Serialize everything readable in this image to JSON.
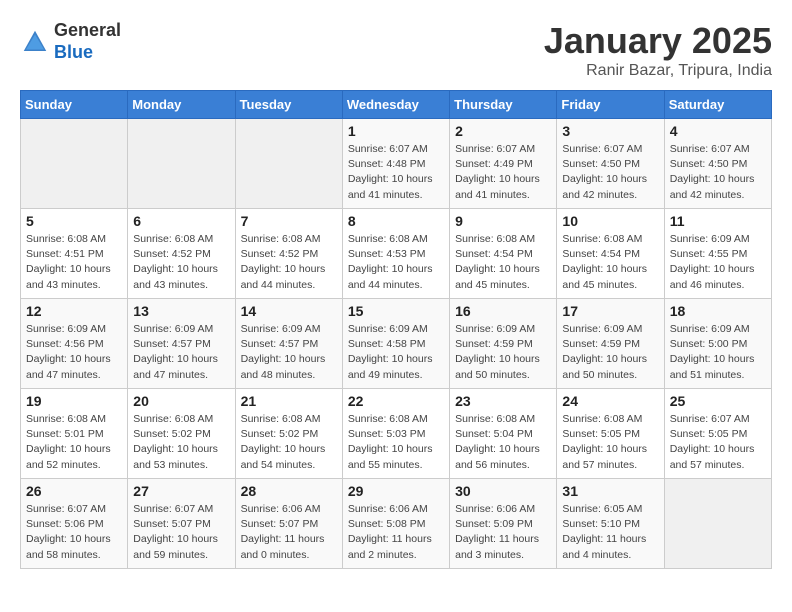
{
  "header": {
    "logo_general": "General",
    "logo_blue": "Blue",
    "title": "January 2025",
    "subtitle": "Ranir Bazar, Tripura, India"
  },
  "days_of_week": [
    "Sunday",
    "Monday",
    "Tuesday",
    "Wednesday",
    "Thursday",
    "Friday",
    "Saturday"
  ],
  "weeks": [
    [
      {
        "day": "",
        "info": ""
      },
      {
        "day": "",
        "info": ""
      },
      {
        "day": "",
        "info": ""
      },
      {
        "day": "1",
        "info": "Sunrise: 6:07 AM\nSunset: 4:48 PM\nDaylight: 10 hours\nand 41 minutes."
      },
      {
        "day": "2",
        "info": "Sunrise: 6:07 AM\nSunset: 4:49 PM\nDaylight: 10 hours\nand 41 minutes."
      },
      {
        "day": "3",
        "info": "Sunrise: 6:07 AM\nSunset: 4:50 PM\nDaylight: 10 hours\nand 42 minutes."
      },
      {
        "day": "4",
        "info": "Sunrise: 6:07 AM\nSunset: 4:50 PM\nDaylight: 10 hours\nand 42 minutes."
      }
    ],
    [
      {
        "day": "5",
        "info": "Sunrise: 6:08 AM\nSunset: 4:51 PM\nDaylight: 10 hours\nand 43 minutes."
      },
      {
        "day": "6",
        "info": "Sunrise: 6:08 AM\nSunset: 4:52 PM\nDaylight: 10 hours\nand 43 minutes."
      },
      {
        "day": "7",
        "info": "Sunrise: 6:08 AM\nSunset: 4:52 PM\nDaylight: 10 hours\nand 44 minutes."
      },
      {
        "day": "8",
        "info": "Sunrise: 6:08 AM\nSunset: 4:53 PM\nDaylight: 10 hours\nand 44 minutes."
      },
      {
        "day": "9",
        "info": "Sunrise: 6:08 AM\nSunset: 4:54 PM\nDaylight: 10 hours\nand 45 minutes."
      },
      {
        "day": "10",
        "info": "Sunrise: 6:08 AM\nSunset: 4:54 PM\nDaylight: 10 hours\nand 45 minutes."
      },
      {
        "day": "11",
        "info": "Sunrise: 6:09 AM\nSunset: 4:55 PM\nDaylight: 10 hours\nand 46 minutes."
      }
    ],
    [
      {
        "day": "12",
        "info": "Sunrise: 6:09 AM\nSunset: 4:56 PM\nDaylight: 10 hours\nand 47 minutes."
      },
      {
        "day": "13",
        "info": "Sunrise: 6:09 AM\nSunset: 4:57 PM\nDaylight: 10 hours\nand 47 minutes."
      },
      {
        "day": "14",
        "info": "Sunrise: 6:09 AM\nSunset: 4:57 PM\nDaylight: 10 hours\nand 48 minutes."
      },
      {
        "day": "15",
        "info": "Sunrise: 6:09 AM\nSunset: 4:58 PM\nDaylight: 10 hours\nand 49 minutes."
      },
      {
        "day": "16",
        "info": "Sunrise: 6:09 AM\nSunset: 4:59 PM\nDaylight: 10 hours\nand 50 minutes."
      },
      {
        "day": "17",
        "info": "Sunrise: 6:09 AM\nSunset: 4:59 PM\nDaylight: 10 hours\nand 50 minutes."
      },
      {
        "day": "18",
        "info": "Sunrise: 6:09 AM\nSunset: 5:00 PM\nDaylight: 10 hours\nand 51 minutes."
      }
    ],
    [
      {
        "day": "19",
        "info": "Sunrise: 6:08 AM\nSunset: 5:01 PM\nDaylight: 10 hours\nand 52 minutes."
      },
      {
        "day": "20",
        "info": "Sunrise: 6:08 AM\nSunset: 5:02 PM\nDaylight: 10 hours\nand 53 minutes."
      },
      {
        "day": "21",
        "info": "Sunrise: 6:08 AM\nSunset: 5:02 PM\nDaylight: 10 hours\nand 54 minutes."
      },
      {
        "day": "22",
        "info": "Sunrise: 6:08 AM\nSunset: 5:03 PM\nDaylight: 10 hours\nand 55 minutes."
      },
      {
        "day": "23",
        "info": "Sunrise: 6:08 AM\nSunset: 5:04 PM\nDaylight: 10 hours\nand 56 minutes."
      },
      {
        "day": "24",
        "info": "Sunrise: 6:08 AM\nSunset: 5:05 PM\nDaylight: 10 hours\nand 57 minutes."
      },
      {
        "day": "25",
        "info": "Sunrise: 6:07 AM\nSunset: 5:05 PM\nDaylight: 10 hours\nand 57 minutes."
      }
    ],
    [
      {
        "day": "26",
        "info": "Sunrise: 6:07 AM\nSunset: 5:06 PM\nDaylight: 10 hours\nand 58 minutes."
      },
      {
        "day": "27",
        "info": "Sunrise: 6:07 AM\nSunset: 5:07 PM\nDaylight: 10 hours\nand 59 minutes."
      },
      {
        "day": "28",
        "info": "Sunrise: 6:06 AM\nSunset: 5:07 PM\nDaylight: 11 hours\nand 0 minutes."
      },
      {
        "day": "29",
        "info": "Sunrise: 6:06 AM\nSunset: 5:08 PM\nDaylight: 11 hours\nand 2 minutes."
      },
      {
        "day": "30",
        "info": "Sunrise: 6:06 AM\nSunset: 5:09 PM\nDaylight: 11 hours\nand 3 minutes."
      },
      {
        "day": "31",
        "info": "Sunrise: 6:05 AM\nSunset: 5:10 PM\nDaylight: 11 hours\nand 4 minutes."
      },
      {
        "day": "",
        "info": ""
      }
    ]
  ]
}
